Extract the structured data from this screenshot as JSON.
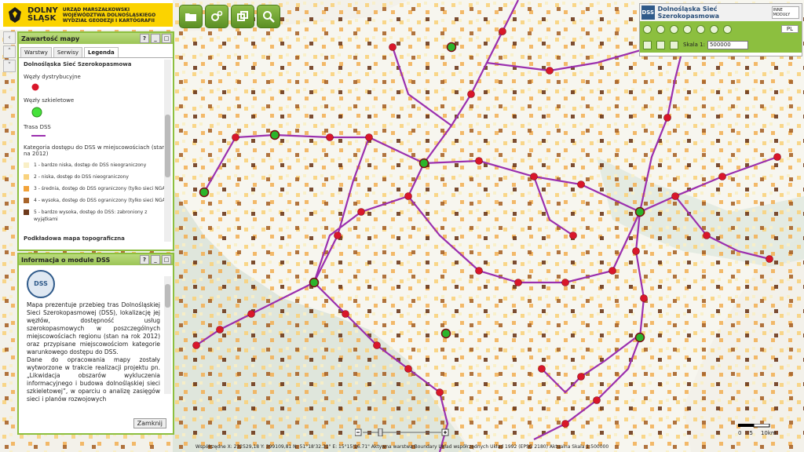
{
  "header": {
    "logo_line1": "DOLNY",
    "logo_line2": "ŚLĄSK",
    "logo_sub": "URZĄD MARSZAŁKOWSKI WOJEWÓDZTWA DOLNOŚLĄSKIEGO WYDZIAŁ GEODEZJI I KARTOGRAFII",
    "buttons": [
      "folder-icon",
      "gears-icon",
      "windows-icon",
      "magnifier-icon"
    ]
  },
  "map_contents_panel": {
    "title": "Zawartość mapy",
    "tabs": [
      "Warstwy",
      "Serwisy",
      "Legenda"
    ],
    "active_tab": "Legenda",
    "legend": {
      "title": "Dolnośląska Sieć Szerokopasmowa",
      "distribution_nodes": "Węzły dystrybucyjne",
      "backbone_nodes": "Węzły szkieletowe",
      "route": "Trasa DSS",
      "category_title": "Kategoria dostępu do DSS w miejscowościach (stan na 2012)",
      "categories": [
        {
          "label": "1 - bardzo niska, dostęp do DSS nieograniczony",
          "color": "#f9efc6"
        },
        {
          "label": "2 - niska, dostęp do DSS nieograniczony",
          "color": "#f9d27d"
        },
        {
          "label": "3 - średnia, dostęp do DSS ograniczony (tylko sieci NGA)",
          "color": "#f2a33a"
        },
        {
          "label": "4 - wysoka, dostęp do DSS ograniczony (tylko sieci NGA)",
          "color": "#a8642a"
        },
        {
          "label": "5 - bardzo wysoka, dostęp do DSS: zabroniony z wyjątkami",
          "color": "#6e3a1c"
        }
      ],
      "footer": "Podkładowa mapa topograficzna"
    }
  },
  "info_panel": {
    "title": "Informacja o module DSS",
    "logo_text": "DSS",
    "paragraph1": "Mapa prezentuje przebieg tras Dolnośląskiej Sieci Szerokopasmowej (DSS), lokalizację jej węzłów, dostępność usług szerokopasmowych w poszczególnych miejscowościach regionu (stan na rok 2012) oraz przypisane miejscowościom kategorie warunkowego dostępu do DSS.",
    "paragraph2": "Dane do opracowania mapy zostały wytworzone w trakcie realizacji projektu pn. „Likwidacja obszarów wykluczenia informacyjnego i budowa dolnośląskiej sieci szkieletowej”, w oparciu o analizę zasięgów sieci i planów rozwojowych",
    "close_label": "Zamknij"
  },
  "right_panel": {
    "logo": "DSS",
    "title": "Dolnośląska Sieć Szerokopasmowa",
    "inne_moduly": "INNE MODUŁY",
    "lang": "PL",
    "scale_label": "Skala 1:",
    "scale_value": "500000"
  },
  "status_bar": {
    "text": "Współrzędne X: 232529,18 Y: 399109,81   N: 51°18'32.31\"  E: 15°15'16.71\"   Aktywna warstwa Boundary   Układ współrzędnych Układ 1992 (EPSG 2180)   Aktualna Skala 1:500000"
  },
  "scalebar": {
    "labels": [
      "0",
      "5",
      "10km"
    ]
  },
  "colors": {
    "accent": "#8cbf3f",
    "route": "#9b2fae",
    "node": "#d9162a",
    "backbone": "#2bb52b"
  }
}
